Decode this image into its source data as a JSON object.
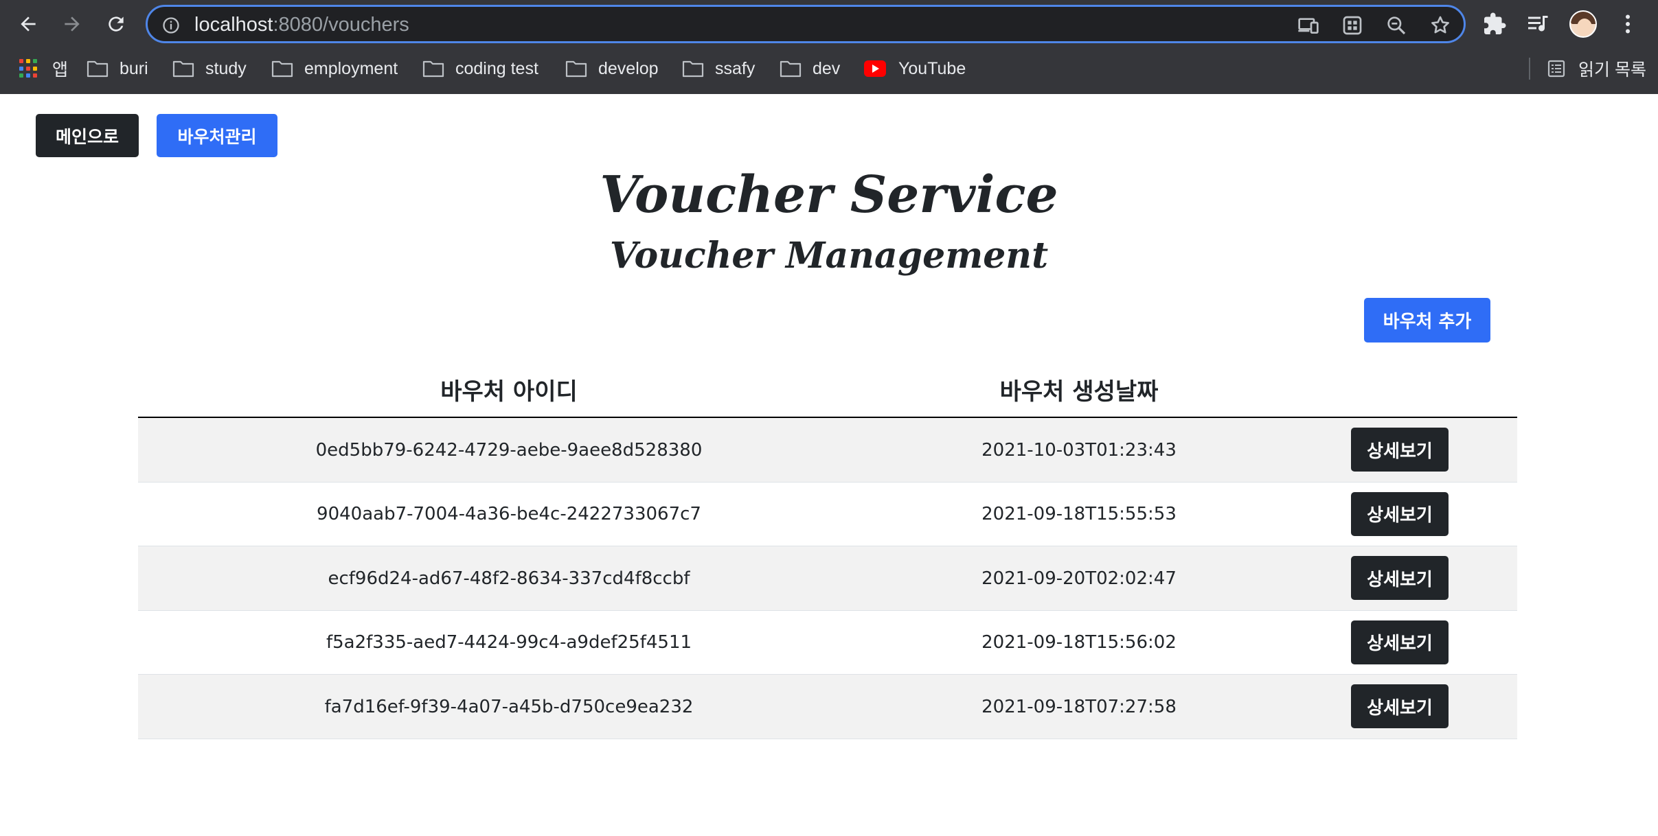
{
  "browser": {
    "url_host": "localhost",
    "url_rest": ":8080/vouchers",
    "bookmarks": [
      {
        "label": "앱"
      },
      {
        "label": "buri"
      },
      {
        "label": "study"
      },
      {
        "label": "employment"
      },
      {
        "label": "coding test"
      },
      {
        "label": "develop"
      },
      {
        "label": "ssafy"
      },
      {
        "label": "dev"
      },
      {
        "label": "YouTube"
      }
    ],
    "reading_list": "읽기 목록"
  },
  "nav": {
    "main_label": "메인으로",
    "manage_label": "바우처관리"
  },
  "header": {
    "title": "Voucher Service",
    "subtitle": "Voucher Management"
  },
  "actions": {
    "add_label": "바우처 추가"
  },
  "table": {
    "columns": [
      "바우처 아이디",
      "바우처 생성날짜"
    ],
    "rows": [
      {
        "id": "0ed5bb79-6242-4729-aebe-9aee8d528380",
        "created": "2021-10-03T01:23:43",
        "action": "상세보기"
      },
      {
        "id": "9040aab7-7004-4a36-be4c-2422733067c7",
        "created": "2021-09-18T15:55:53",
        "action": "상세보기"
      },
      {
        "id": "ecf96d24-ad67-48f2-8634-337cd4f8ccbf",
        "created": "2021-09-20T02:02:47",
        "action": "상세보기"
      },
      {
        "id": "f5a2f335-aed7-4424-99c4-a9def25f4511",
        "created": "2021-09-18T15:56:02",
        "action": "상세보기"
      },
      {
        "id": "fa7d16ef-9f39-4a07-a45b-d750ce9ea232",
        "created": "2021-09-18T07:27:58",
        "action": "상세보기"
      }
    ]
  },
  "colors": {
    "dark_button": "#212529",
    "blue_button": "#2f6df6",
    "omnibox_focus": "#4f86e8",
    "row_stripe": "#f2f2f2"
  }
}
